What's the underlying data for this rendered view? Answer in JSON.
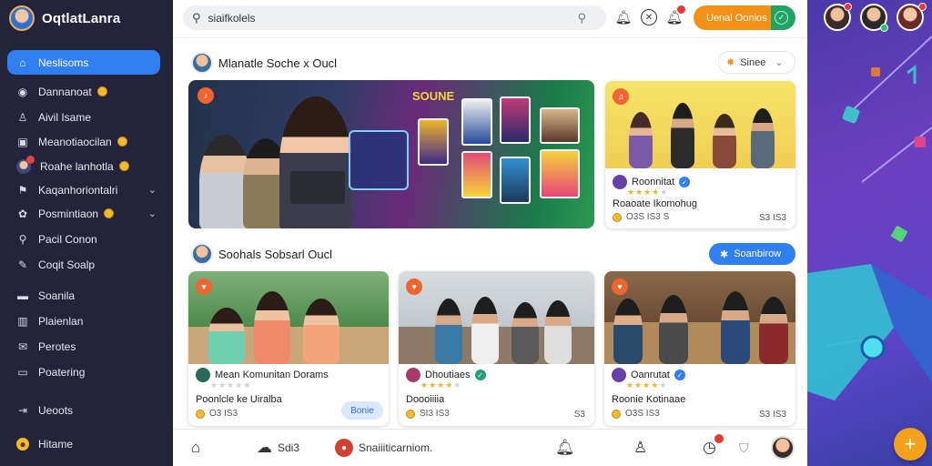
{
  "app": {
    "name": "OqtlatLanra"
  },
  "sidebar": {
    "items": [
      {
        "label": "Neslisoms",
        "icon": "home-icon",
        "active": true
      },
      {
        "label": "Dannanoat",
        "icon": "compass-icon",
        "coin": true
      },
      {
        "label": "Aivil Isame",
        "icon": "users-icon"
      },
      {
        "label": "Meanotiaocilan",
        "icon": "calendar-icon",
        "coin": true
      },
      {
        "label": "Roahe lanhotla",
        "icon": "avatar-icon",
        "coin": true
      },
      {
        "label": "Kaqanhoriontalri",
        "icon": "flag-icon",
        "chevron": true
      },
      {
        "label": "Posmintiaon",
        "icon": "settings-icon",
        "coin": true,
        "chevron": true
      },
      {
        "label": "Pacil Conon",
        "icon": "search-icon"
      },
      {
        "label": "Coqit Soalp",
        "icon": "edit-icon"
      },
      {
        "label": "Soanila",
        "icon": "folder-icon"
      },
      {
        "label": "Plaienlan",
        "icon": "building-icon"
      },
      {
        "label": "Perotes",
        "icon": "mail-icon"
      },
      {
        "label": "Poatering",
        "icon": "monitor-icon"
      },
      {
        "label": "Ueoots",
        "icon": "logout-icon"
      },
      {
        "label": "Hitame",
        "icon": "profile-icon"
      }
    ]
  },
  "topbar": {
    "search_text": "siaifkolels",
    "cta_label": "Uenal Oonios"
  },
  "section1": {
    "title": "Mlanatle Soche x Oucl",
    "sort_label": "Sinee"
  },
  "hero": {
    "overlay_text": "SOUNE"
  },
  "card_featured": {
    "name": "Roonnitat",
    "line": "Roaoate Ikomohug",
    "meta": "O3S IS3 S",
    "right": "S3 IS3"
  },
  "section2": {
    "title": "Soohals Sobsarl Oucl",
    "pill_label": "Soanbirow"
  },
  "cards": [
    {
      "name": "Mean Komunitan Dorams",
      "line": "Poonlcle ke Uiralba",
      "meta": "O3 IS3",
      "button": "Bonie"
    },
    {
      "name": "Dhoutiaes",
      "line": "Doooiiiia",
      "meta": "SI3 IS3",
      "right": "S3"
    },
    {
      "name": "Oanrutat",
      "line": "Roonie Kotinaae",
      "meta": "O3S IS3",
      "right": "S3 IS3"
    }
  ],
  "bottombar": {
    "item2": "Sdi3",
    "item3": "Snaiiiticarniom."
  },
  "colors": {
    "accent": "#2f7ff0",
    "cta": "#f39117",
    "sidebar": "#23243a",
    "right_panel": "#5c45c9"
  }
}
